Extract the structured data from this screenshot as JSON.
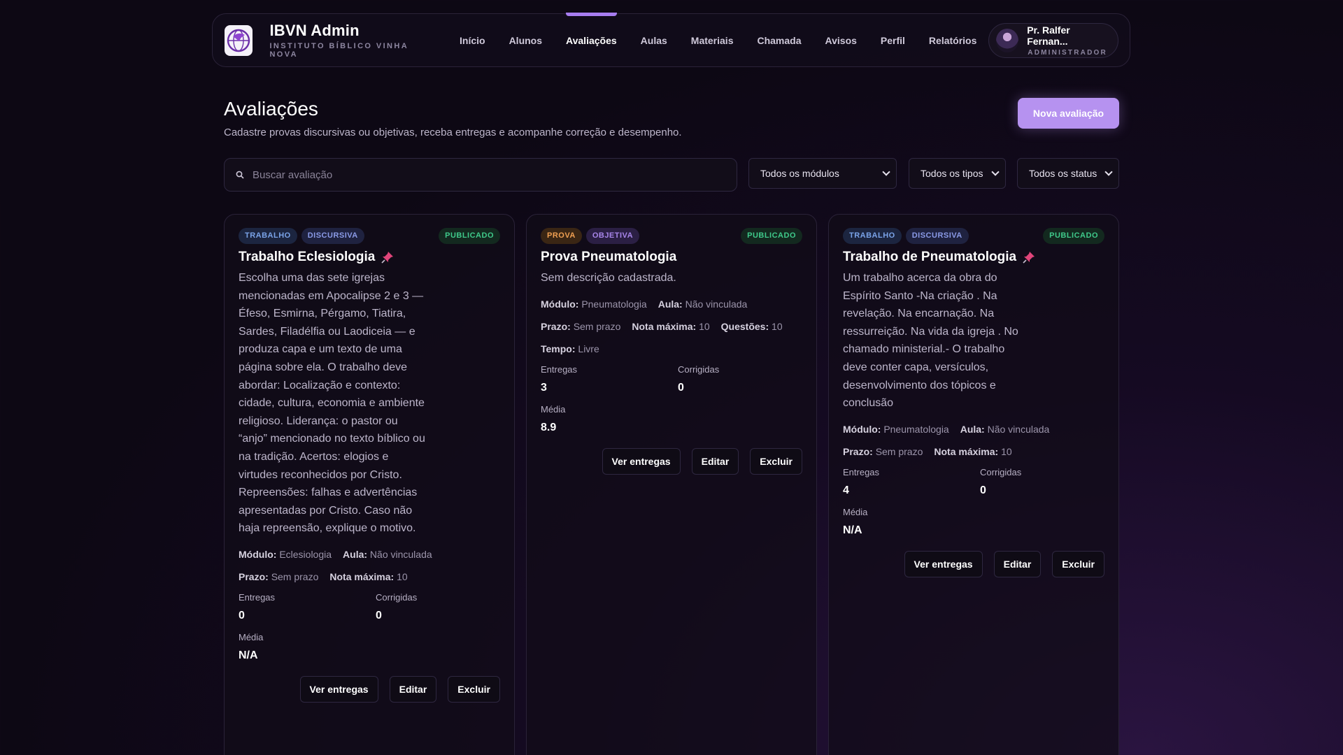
{
  "header": {
    "brand_title": "IBVN Admin",
    "brand_subtitle": "INSTITUTO BÍBLICO VINHA NOVA",
    "nav": [
      {
        "label": "Início",
        "active": false
      },
      {
        "label": "Alunos",
        "active": false
      },
      {
        "label": "Avaliações",
        "active": true
      },
      {
        "label": "Aulas",
        "active": false
      },
      {
        "label": "Materiais",
        "active": false
      },
      {
        "label": "Chamada",
        "active": false
      },
      {
        "label": "Avisos",
        "active": false
      },
      {
        "label": "Perfil",
        "active": false
      },
      {
        "label": "Relatórios",
        "active": false
      }
    ],
    "user": {
      "name": "Pr. Ralfer Fernan...",
      "role": "ADMINISTRADOR"
    }
  },
  "page": {
    "title": "Avaliações",
    "description": "Cadastre provas discursivas ou objetivas, receba entregas e acompanhe correção e desempenho.",
    "new_button": "Nova avaliação"
  },
  "filters": {
    "search_placeholder": "Buscar avaliação",
    "module": "Todos os módulos",
    "type": "Todos os tipos",
    "status": "Todos os status"
  },
  "labels": {
    "modulo": "Módulo:",
    "aula": "Aula:",
    "prazo": "Prazo:",
    "nota_maxima": "Nota máxima:",
    "questoes": "Questões:",
    "tempo": "Tempo:",
    "entregas": "Entregas",
    "corrigidas": "Corrigidas",
    "media": "Média",
    "ver_entregas": "Ver entregas",
    "editar": "Editar",
    "excluir": "Excluir"
  },
  "cards": [
    {
      "tag1": "TRABALHO",
      "tag2": "DISCURSIVA",
      "status": "PUBLICADO",
      "title": "Trabalho Eclesiologia",
      "pinned": true,
      "description": "Escolha uma das sete igrejas mencionadas em Apocalipse 2 e 3 — Éfeso, Esmirna, Pérgamo, Tiatira, Sardes, Filadélfia ou Laodiceia — e produza capa e um texto de uma página sobre ela. O trabalho deve abordar: Localização e contexto: cidade, cultura, economia e ambiente religioso. Liderança: o pastor ou “anjo” mencionado no texto bíblico ou na tradição. Acertos: elogios e virtudes reconhecidos por Cristo. Repreensões: falhas e advertências apresentadas por Cristo. Caso não haja repreensão, explique o motivo.",
      "modulo": "Eclesiologia",
      "aula": "Não vinculada",
      "prazo": "Sem prazo",
      "nota_maxima": "10",
      "entregas": "0",
      "corrigidas": "0",
      "media": "N/A"
    },
    {
      "tag1": "PROVA",
      "tag2": "OBJETIVA",
      "status": "PUBLICADO",
      "title": "Prova Pneumatologia",
      "pinned": false,
      "description": "Sem descrição cadastrada.",
      "modulo": "Pneumatologia",
      "aula": "Não vinculada",
      "prazo": "Sem prazo",
      "nota_maxima": "10",
      "questoes": "10",
      "tempo": "Livre",
      "entregas": "3",
      "corrigidas": "0",
      "media": "8.9"
    },
    {
      "tag1": "TRABALHO",
      "tag2": "DISCURSIVA",
      "status": "PUBLICADO",
      "title": "Trabalho de Pneumatologia",
      "pinned": true,
      "description": "Um trabalho acerca da obra do Espírito Santo -Na criação . Na revelação. Na encarnação. Na ressurreição. Na vida da igreja . No chamado ministerial.- O trabalho deve conter capa, versículos, desenvolvimento dos tópicos e conclusão",
      "modulo": "Pneumatologia",
      "aula": "Não vinculada",
      "prazo": "Sem prazo",
      "nota_maxima": "10",
      "entregas": "4",
      "corrigidas": "0",
      "media": "N/A"
    }
  ],
  "colors": {
    "accent": "#b692f0",
    "nav_active_indicator": "#a77df0",
    "published": "#3fc98a",
    "pin": "#e0457a"
  },
  "icons": {
    "logo": "dove-globe-logo",
    "search": "search-icon",
    "pin": "pushpin-icon",
    "dropdown": "chevron-down-icon"
  }
}
